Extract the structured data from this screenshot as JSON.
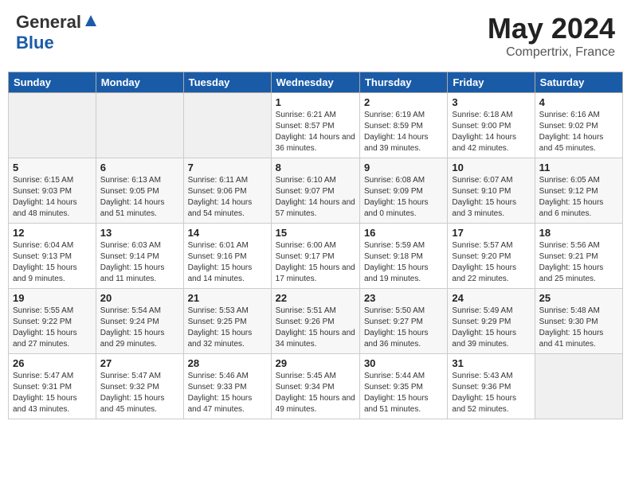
{
  "header": {
    "logo_line1": "General",
    "logo_line2": "Blue",
    "month": "May 2024",
    "location": "Compertrix, France"
  },
  "days_of_week": [
    "Sunday",
    "Monday",
    "Tuesday",
    "Wednesday",
    "Thursday",
    "Friday",
    "Saturday"
  ],
  "weeks": [
    [
      {
        "day": "",
        "info": ""
      },
      {
        "day": "",
        "info": ""
      },
      {
        "day": "",
        "info": ""
      },
      {
        "day": "1",
        "info": "Sunrise: 6:21 AM\nSunset: 8:57 PM\nDaylight: 14 hours and 36 minutes."
      },
      {
        "day": "2",
        "info": "Sunrise: 6:19 AM\nSunset: 8:59 PM\nDaylight: 14 hours and 39 minutes."
      },
      {
        "day": "3",
        "info": "Sunrise: 6:18 AM\nSunset: 9:00 PM\nDaylight: 14 hours and 42 minutes."
      },
      {
        "day": "4",
        "info": "Sunrise: 6:16 AM\nSunset: 9:02 PM\nDaylight: 14 hours and 45 minutes."
      }
    ],
    [
      {
        "day": "5",
        "info": "Sunrise: 6:15 AM\nSunset: 9:03 PM\nDaylight: 14 hours and 48 minutes."
      },
      {
        "day": "6",
        "info": "Sunrise: 6:13 AM\nSunset: 9:05 PM\nDaylight: 14 hours and 51 minutes."
      },
      {
        "day": "7",
        "info": "Sunrise: 6:11 AM\nSunset: 9:06 PM\nDaylight: 14 hours and 54 minutes."
      },
      {
        "day": "8",
        "info": "Sunrise: 6:10 AM\nSunset: 9:07 PM\nDaylight: 14 hours and 57 minutes."
      },
      {
        "day": "9",
        "info": "Sunrise: 6:08 AM\nSunset: 9:09 PM\nDaylight: 15 hours and 0 minutes."
      },
      {
        "day": "10",
        "info": "Sunrise: 6:07 AM\nSunset: 9:10 PM\nDaylight: 15 hours and 3 minutes."
      },
      {
        "day": "11",
        "info": "Sunrise: 6:05 AM\nSunset: 9:12 PM\nDaylight: 15 hours and 6 minutes."
      }
    ],
    [
      {
        "day": "12",
        "info": "Sunrise: 6:04 AM\nSunset: 9:13 PM\nDaylight: 15 hours and 9 minutes."
      },
      {
        "day": "13",
        "info": "Sunrise: 6:03 AM\nSunset: 9:14 PM\nDaylight: 15 hours and 11 minutes."
      },
      {
        "day": "14",
        "info": "Sunrise: 6:01 AM\nSunset: 9:16 PM\nDaylight: 15 hours and 14 minutes."
      },
      {
        "day": "15",
        "info": "Sunrise: 6:00 AM\nSunset: 9:17 PM\nDaylight: 15 hours and 17 minutes."
      },
      {
        "day": "16",
        "info": "Sunrise: 5:59 AM\nSunset: 9:18 PM\nDaylight: 15 hours and 19 minutes."
      },
      {
        "day": "17",
        "info": "Sunrise: 5:57 AM\nSunset: 9:20 PM\nDaylight: 15 hours and 22 minutes."
      },
      {
        "day": "18",
        "info": "Sunrise: 5:56 AM\nSunset: 9:21 PM\nDaylight: 15 hours and 25 minutes."
      }
    ],
    [
      {
        "day": "19",
        "info": "Sunrise: 5:55 AM\nSunset: 9:22 PM\nDaylight: 15 hours and 27 minutes."
      },
      {
        "day": "20",
        "info": "Sunrise: 5:54 AM\nSunset: 9:24 PM\nDaylight: 15 hours and 29 minutes."
      },
      {
        "day": "21",
        "info": "Sunrise: 5:53 AM\nSunset: 9:25 PM\nDaylight: 15 hours and 32 minutes."
      },
      {
        "day": "22",
        "info": "Sunrise: 5:51 AM\nSunset: 9:26 PM\nDaylight: 15 hours and 34 minutes."
      },
      {
        "day": "23",
        "info": "Sunrise: 5:50 AM\nSunset: 9:27 PM\nDaylight: 15 hours and 36 minutes."
      },
      {
        "day": "24",
        "info": "Sunrise: 5:49 AM\nSunset: 9:29 PM\nDaylight: 15 hours and 39 minutes."
      },
      {
        "day": "25",
        "info": "Sunrise: 5:48 AM\nSunset: 9:30 PM\nDaylight: 15 hours and 41 minutes."
      }
    ],
    [
      {
        "day": "26",
        "info": "Sunrise: 5:47 AM\nSunset: 9:31 PM\nDaylight: 15 hours and 43 minutes."
      },
      {
        "day": "27",
        "info": "Sunrise: 5:47 AM\nSunset: 9:32 PM\nDaylight: 15 hours and 45 minutes."
      },
      {
        "day": "28",
        "info": "Sunrise: 5:46 AM\nSunset: 9:33 PM\nDaylight: 15 hours and 47 minutes."
      },
      {
        "day": "29",
        "info": "Sunrise: 5:45 AM\nSunset: 9:34 PM\nDaylight: 15 hours and 49 minutes."
      },
      {
        "day": "30",
        "info": "Sunrise: 5:44 AM\nSunset: 9:35 PM\nDaylight: 15 hours and 51 minutes."
      },
      {
        "day": "31",
        "info": "Sunrise: 5:43 AM\nSunset: 9:36 PM\nDaylight: 15 hours and 52 minutes."
      },
      {
        "day": "",
        "info": ""
      }
    ]
  ]
}
